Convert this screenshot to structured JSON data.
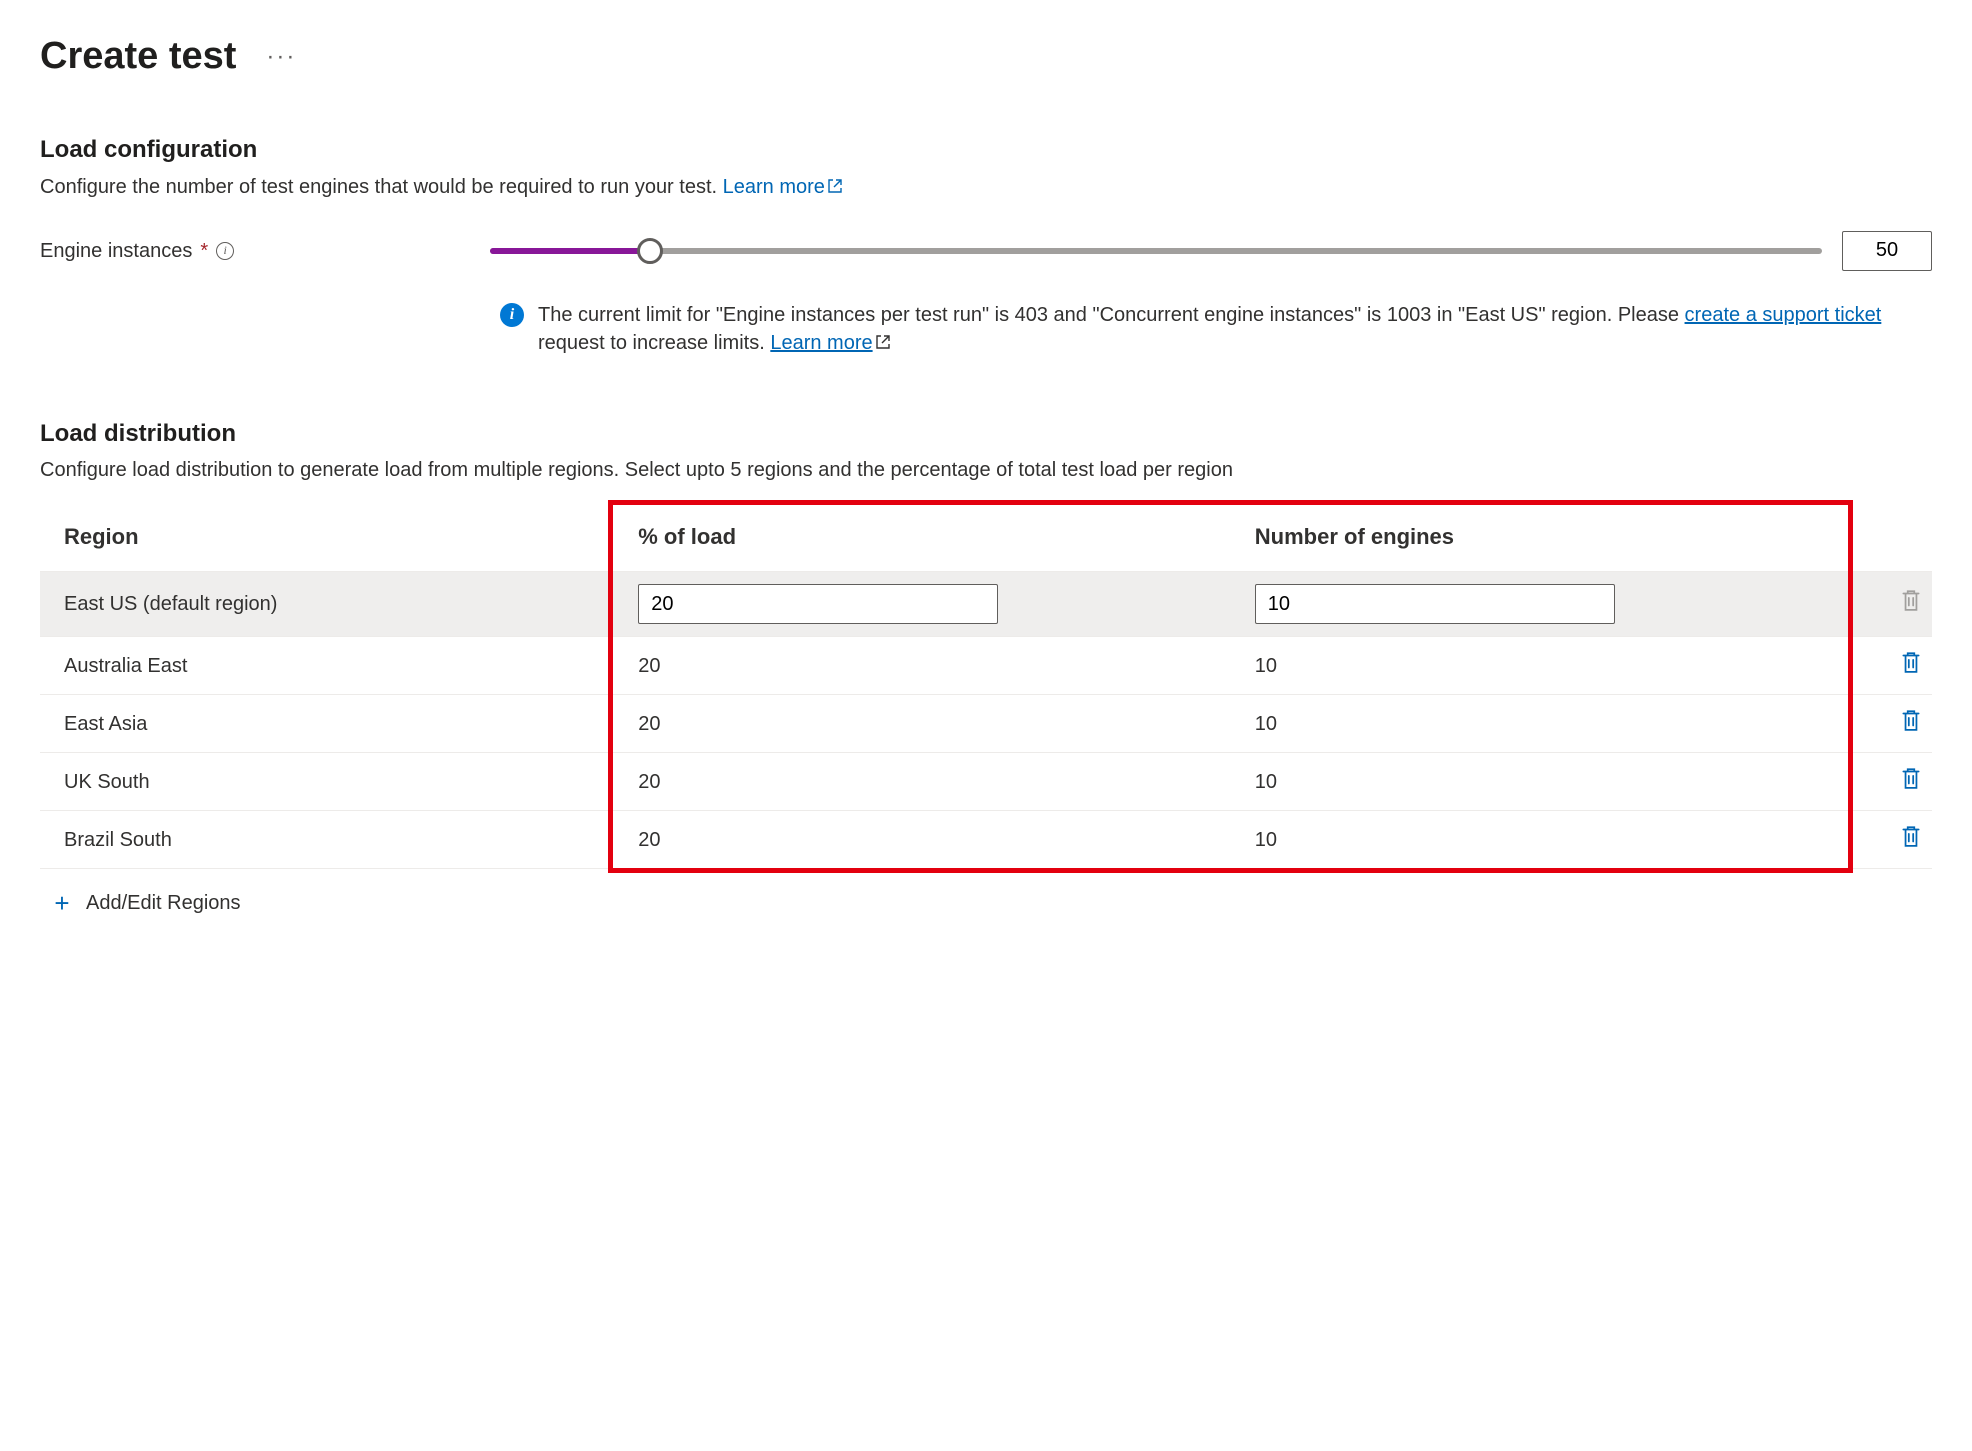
{
  "page": {
    "title": "Create test"
  },
  "loadConfig": {
    "sectionTitle": "Load configuration",
    "description": "Configure the number of test engines that would be required to run your test. ",
    "learnMore": "Learn more",
    "sliderLabel": "Engine instances",
    "sliderValue": "50",
    "sliderPercent": 12,
    "infoMsg": {
      "p1": "The current limit for \"Engine instances per test run\" is 403 and \"Concurrent engine instances\" is 1003 in \"East US\" region. Please ",
      "link1": "create a support ticket",
      "p2": " request to increase limits. ",
      "link2": "Learn more"
    }
  },
  "loadDist": {
    "sectionTitle": "Load distribution",
    "description": "Configure load distribution to generate load from multiple regions. Select upto 5 regions and the percentage of total test load per region",
    "headers": {
      "region": "Region",
      "pct": "% of load",
      "num": "Number of engines"
    },
    "rows": [
      {
        "region": "East US (default region)",
        "pct": "20",
        "num": "10",
        "editable": true,
        "deletable": false
      },
      {
        "region": "Australia East",
        "pct": "20",
        "num": "10",
        "editable": false,
        "deletable": true
      },
      {
        "region": "East Asia",
        "pct": "20",
        "num": "10",
        "editable": false,
        "deletable": true
      },
      {
        "region": "UK South",
        "pct": "20",
        "num": "10",
        "editable": false,
        "deletable": true
      },
      {
        "region": "Brazil South",
        "pct": "20",
        "num": "10",
        "editable": false,
        "deletable": true
      }
    ],
    "addLabel": "Add/Edit Regions"
  }
}
